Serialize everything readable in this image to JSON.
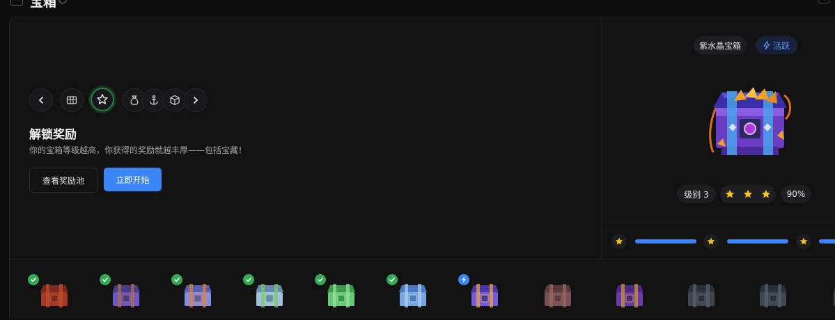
{
  "header": {
    "title": "宝箱",
    "menu_icon": "sidebar-icon",
    "info_icon": "info-icon"
  },
  "left": {
    "nav_icons": [
      "chevron-left-icon",
      "grid-icon",
      "star-icon",
      "money-bag-icon",
      "anchor-icon",
      "cube-icon",
      "chevron-right-icon"
    ],
    "selected_icon": "star-icon",
    "heading": "解锁奖励",
    "subtitle": "你的宝箱等级越高，你获得的奖励就越丰厚——包括宝藏！",
    "buttons": {
      "view_pool": "查看奖励池",
      "start": "立即开始"
    }
  },
  "right": {
    "chest_name": "紫水晶宝箱",
    "status": "活跃",
    "level": "级别 3",
    "stars": 3,
    "percent": "90%"
  },
  "colors": {
    "accent": "#3a86f7",
    "success": "#34a853",
    "star": "#f5c518",
    "bg": "#121213"
  },
  "bottom": {
    "chests": [
      {
        "id": "c1",
        "state": "done"
      },
      {
        "id": "c2",
        "state": "done"
      },
      {
        "id": "c3",
        "state": "done"
      },
      {
        "id": "c4",
        "state": "done"
      },
      {
        "id": "c5",
        "state": "done"
      },
      {
        "id": "c6",
        "state": "done"
      },
      {
        "id": "c7",
        "state": "active"
      },
      {
        "id": "c8",
        "state": "locked"
      },
      {
        "id": "c9",
        "state": "locked"
      },
      {
        "id": "c10",
        "state": "locked"
      },
      {
        "id": "c11",
        "state": "locked"
      },
      {
        "id": "c12",
        "state": "locked"
      }
    ]
  }
}
